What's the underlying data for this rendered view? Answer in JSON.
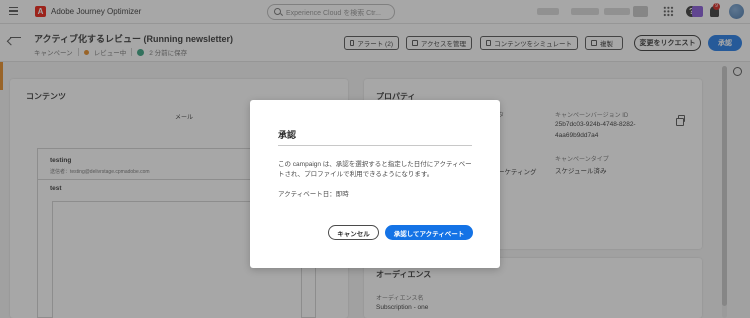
{
  "topbar": {
    "app_name": "Adobe Journey Optimizer",
    "logo_letter": "A",
    "search_placeholder": "Experience Cloud を検索 Ctr...",
    "notification_count": "9",
    "help_label": "?"
  },
  "header": {
    "title": "アクティブ化するレビュー (Running newsletter)",
    "breadcrumb_type": "キャンペーン",
    "status": "レビュー中",
    "saved": "2 分前に保存",
    "buttons": {
      "alerts": "アラート (2)",
      "manage_access": "アクセスを管理",
      "simulate": "コンテンツをシミュレート",
      "duplicate": "複製",
      "request_changes": "変更をリクエスト",
      "approve": "承認"
    }
  },
  "content_panel": {
    "title": "コンテンツ",
    "channel": "メール",
    "email": {
      "subject": "testing",
      "from": "送信者：testing@delivrstage.cpmadobe.com",
      "body_title": "test"
    }
  },
  "properties_panel": {
    "title": "プロパティ",
    "version_label": "キャンペーンバージョン ID",
    "version_value_line1": "25b7dc03-924b-4748-8282-",
    "version_value_line2": "4aa69b9dd7a4",
    "partial_label": "タ",
    "marketing_text": "ーケティング",
    "campaign_type_label": "キャンペーンタイプ",
    "campaign_type_value": "スケジュール済み"
  },
  "audience_panel": {
    "title": "オーディエンス",
    "label": "オーディエンス名",
    "value": "Subscription - one"
  },
  "dialog": {
    "title": "承認",
    "body": "この campaign は、承認を選択すると指定した日付にアクティベートされ、プロファイルで利用できるようになります。",
    "activation": "アクティベート日：即時",
    "cancel": "キャンセル",
    "approve_activate": "承認してアクティベート"
  },
  "colors": {
    "primary": "#1473e6",
    "status_orange": "#e68619",
    "saved_green": "#2d9d78",
    "adobe_red": "#eb1000"
  }
}
